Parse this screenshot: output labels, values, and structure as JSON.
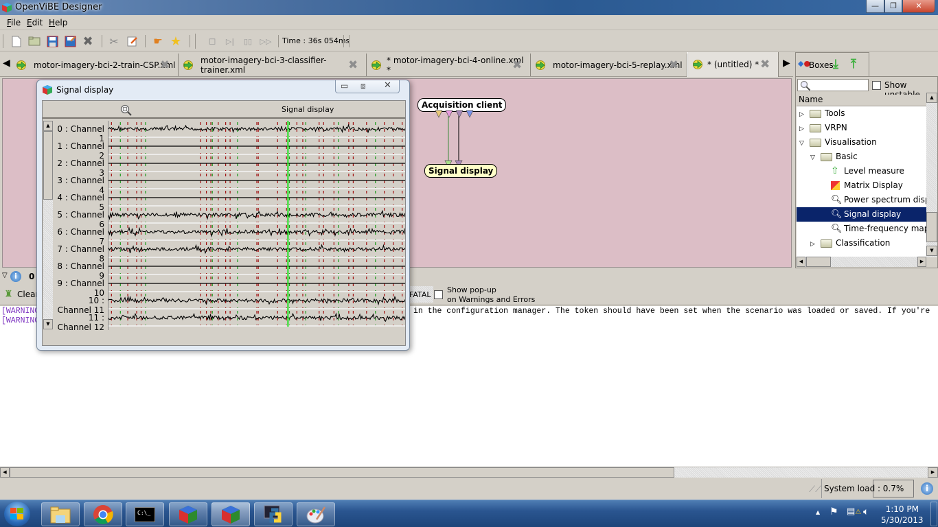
{
  "window": {
    "title": "OpenViBE Designer",
    "minimize": "—",
    "restore": "❐",
    "close": "✕"
  },
  "menu": [
    {
      "label": "File",
      "key": "F",
      "rest": "ile"
    },
    {
      "label": "Edit",
      "key": "E",
      "rest": "dit"
    },
    {
      "label": "Help",
      "key": "H",
      "rest": "elp"
    }
  ],
  "toolbar": {
    "icons": [
      "new-icon",
      "open-icon",
      "save-icon",
      "save-as-icon",
      "close-scenario-icon",
      "settings-icon",
      "edit-comment-icon",
      "hand-cursor-icon",
      "star-icon"
    ],
    "playback": [
      "stop-icon",
      "step-icon",
      "pause-icon",
      "fast-forward-icon"
    ],
    "time": "Time : 36s 054ms"
  },
  "tabs": [
    {
      "label": "motor-imagery-bci-2-train-CSP.xml",
      "active": false
    },
    {
      "label": "motor-imagery-bci-3-classifier-trainer.xml",
      "active": false
    },
    {
      "label": "* motor-imagery-bci-4-online.xml *",
      "active": false
    },
    {
      "label": "motor-imagery-bci-5-replay.xml",
      "active": false
    },
    {
      "label": "* (untitled) *",
      "active": true
    }
  ],
  "scenario": {
    "boxes": [
      {
        "label": "Acquisition client"
      },
      {
        "label": "Signal display"
      }
    ],
    "acq_outputs": [
      "#e8c878",
      "#e89ae0",
      "#a888b8",
      "#7890e8"
    ],
    "sd_inputs": [
      "#a8e088",
      "#a888b8"
    ]
  },
  "boxes_panel": {
    "tab_label": "Boxes",
    "search_placeholder": "",
    "show_unstable": "Show unstable",
    "column": "Name",
    "tree": [
      {
        "label": "Tools",
        "level": 0,
        "type": "folder",
        "expander": "▷"
      },
      {
        "label": "VRPN",
        "level": 0,
        "type": "folder",
        "expander": "▷"
      },
      {
        "label": "Visualisation",
        "level": 0,
        "type": "folder",
        "expander": "▽"
      },
      {
        "label": "Basic",
        "level": 1,
        "type": "folder",
        "expander": "▽"
      },
      {
        "label": "Level measure",
        "level": 2,
        "type": "box",
        "icon": "up-arrow-icon"
      },
      {
        "label": "Matrix Display",
        "level": 2,
        "type": "box",
        "icon": "matrix-icon"
      },
      {
        "label": "Power spectrum display",
        "level": 2,
        "type": "box",
        "icon": "zoom-icon"
      },
      {
        "label": "Signal display",
        "level": 2,
        "type": "box",
        "icon": "zoom-icon",
        "selected": true
      },
      {
        "label": "Time-frequency map disp",
        "level": 2,
        "type": "box",
        "icon": "zoom-icon"
      },
      {
        "label": "Classification",
        "level": 1,
        "type": "folder",
        "expander": "▷"
      }
    ]
  },
  "signal_window": {
    "title": "Signal display",
    "header": "Signal display",
    "channels": [
      "0 : Channel 1",
      "1 : Channel 2",
      "2 : Channel 3",
      "3 : Channel 4",
      "4 : Channel 5",
      "5 : Channel 6",
      "6 : Channel 7",
      "7 : Channel 8",
      "8 : Channel 9",
      "9 : Channel 10",
      "10 : Channel 11",
      "11 : Channel 12"
    ],
    "active_channels": [
      0,
      5,
      6,
      7,
      10,
      11
    ],
    "x_ticks": [
      "30",
      "35"
    ],
    "time_range": [
      30,
      40
    ],
    "cursor_time": 36.05
  },
  "log": {
    "header_label": "0",
    "clear": "Clear",
    "fatal": "FATAL",
    "popup_line1": "Show pop-up",
    "popup_line2": "on Warnings and Errors",
    "lines": [
      {
        "tag": "[WARNING",
        "text": "in the configuration manager. The token should have been set when the scenario was loaded or saved. If you're"
      },
      {
        "tag": "[WARNING",
        "text": ""
      }
    ]
  },
  "status": {
    "system_load_label": "System load :",
    "system_load_value": "0.7%"
  },
  "taskbar": {
    "apps": [
      "start-orb",
      "explorer-icon",
      "chrome-icon",
      "cmd-icon",
      "gtk-icon",
      "gtk-icon",
      "python-icon",
      "paint-icon"
    ],
    "time": "1:10 PM",
    "date": "5/30/2013"
  }
}
